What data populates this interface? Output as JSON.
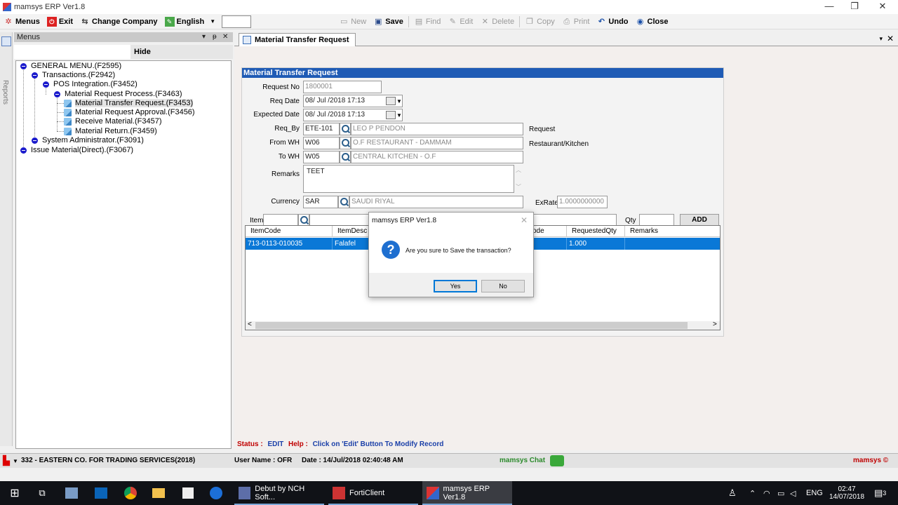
{
  "window": {
    "title": "mamsys ERP Ver1.8",
    "minimize": "—",
    "maximize": "❐",
    "close": "✕"
  },
  "toolbar": {
    "menus": "Menus",
    "exit": "Exit",
    "change_company": "Change Company",
    "language": "English",
    "new": "New",
    "save": "Save",
    "find": "Find",
    "edit": "Edit",
    "delete": "Delete",
    "copy": "Copy",
    "print": "Print",
    "undo": "Undo",
    "close": "Close"
  },
  "sidebar_strip": {
    "reports": "Reports"
  },
  "menus_panel": {
    "title": "Menus",
    "pin": "▾",
    "dock": "ᵽ",
    "close": "✕",
    "hide_button": "Hide",
    "tree": [
      {
        "label": "GENERAL MENU.(F2595)"
      },
      {
        "label": "Transactions.(F2942)"
      },
      {
        "label": "POS Integration.(F3452)"
      },
      {
        "label": "Material Request Process.(F3463)"
      },
      {
        "label": "Material Transfer Request.(F3453)"
      },
      {
        "label": "Material Request Approval.(F3456)"
      },
      {
        "label": "Receive Material.(F3457)"
      },
      {
        "label": "Material Return.(F3459)"
      },
      {
        "label": "System Administrator.(F3091)"
      },
      {
        "label": "Issue Material(Direct).(F3067)"
      }
    ]
  },
  "document": {
    "tab": "Material Transfer Request",
    "close": "✕",
    "close_all": "▾"
  },
  "form": {
    "title": "Material Transfer Request",
    "request_no_label": "Request No",
    "request_no": "1800001",
    "req_date_label": "Req Date",
    "req_date": "08/ Jul /2018 17:13",
    "expected_date_label": "Expected Date",
    "expected_date": "08/ Jul /2018 17:13",
    "req_by_label": "Req_By",
    "req_by_code": "ETE-101",
    "req_by_name": "LEO P PENDON",
    "req_by_note": "Request",
    "from_wh_label": "From WH",
    "from_wh_code": "W06",
    "from_wh_name": "O.F RESTAURANT - DAMMAM",
    "from_wh_note": "Restaurant/Kitchen",
    "to_wh_label": "To WH",
    "to_wh_code": "W05",
    "to_wh_name": "CENTRAL KITCHEN - O.F",
    "remarks_label": "Remarks",
    "remarks": "TEET",
    "currency_label": "Currency",
    "currency_code": "SAR",
    "currency_name": "SAUDI RIYAL",
    "exrate_label": "ExRate",
    "exrate": "1.0000000000",
    "item_label": "Item",
    "qty_label": "Qty",
    "add_button": "ADD"
  },
  "grid": {
    "columns": [
      "ItemCode",
      "ItemDesc",
      "ode",
      "RequestedQty",
      "Remarks"
    ],
    "rows": [
      {
        "item_code": "713-0113-010035",
        "item_desc": "Falafel",
        "uom": "",
        "requested_qty": "1.000",
        "remarks": ""
      }
    ],
    "scroll_left": "<",
    "scroll_right": ">"
  },
  "status": {
    "status_label": "Status :",
    "status_value": "EDIT",
    "help_label": "Help :",
    "help_value": "Click on 'Edit' Button To Modify Record"
  },
  "app_status": {
    "company": "332 - EASTERN CO. FOR TRADING SERVICES(2018)",
    "user": "User Name : OFR",
    "date": "Date : 14/Jul/2018 02:40:48 AM",
    "chat": "mamsys Chat",
    "brand": "mamsys ©"
  },
  "dialog": {
    "title": "mamsys ERP Ver1.8",
    "message": "Are you sure to Save the transaction?",
    "yes": "Yes",
    "no": "No",
    "close": "✕",
    "icon": "?"
  },
  "taskbar": {
    "apps": [
      {
        "label": "Debut by NCH Soft..."
      },
      {
        "label": "FortiClient"
      },
      {
        "label": "mamsys ERP Ver1.8"
      }
    ],
    "lang": "ENG",
    "time": "02:47",
    "date": "14/07/2018",
    "notif_count": "3"
  },
  "colors": {
    "accent": "#1f5bb5",
    "selection": "#0a78d7",
    "status_red": "#c00000",
    "help_blue": "#1a3fa8",
    "chat_green": "#2b8a2b"
  }
}
